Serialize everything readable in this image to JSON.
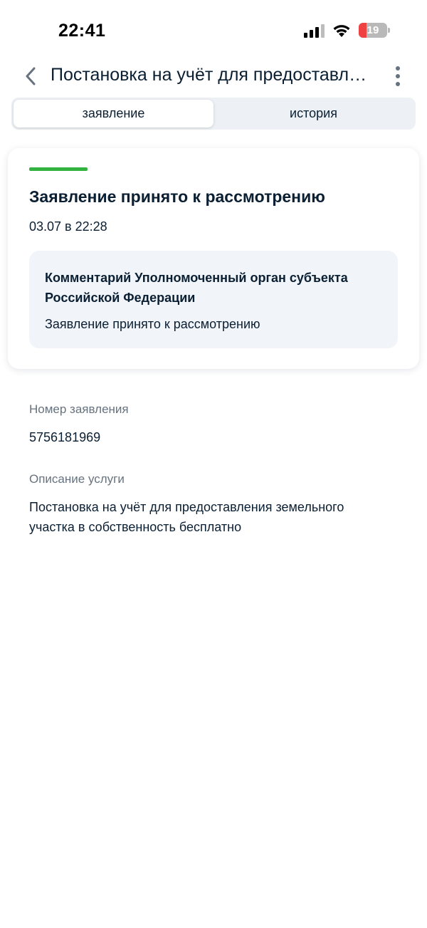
{
  "status_bar": {
    "time": "22:41",
    "battery_level": "19",
    "icons": [
      "signal-icon",
      "wifi-icon",
      "battery-icon"
    ]
  },
  "nav": {
    "title": "Постановка на учёт для предоставления земельного участка в собственность бесплатно",
    "back_icon": "chevron-left-icon",
    "more_icon": "more-vertical-icon"
  },
  "tabs": [
    {
      "label": "заявление",
      "active": true
    },
    {
      "label": "история",
      "active": false
    }
  ],
  "status_card": {
    "accent_color": "#34b23f",
    "title": "Заявление принято к рассмотрению",
    "date": "03.07 в 22:28",
    "comment": {
      "title": "Комментарий Уполномоченный орган субъекта Российской Федерации",
      "text": "Заявление принято к рассмотрению"
    }
  },
  "details": [
    {
      "label": "Номер заявления",
      "value": "5756181969"
    },
    {
      "label": "Описание услуги",
      "value": "Постановка на учёт для предоставления земельного участка в собственность бесплатно"
    }
  ]
}
